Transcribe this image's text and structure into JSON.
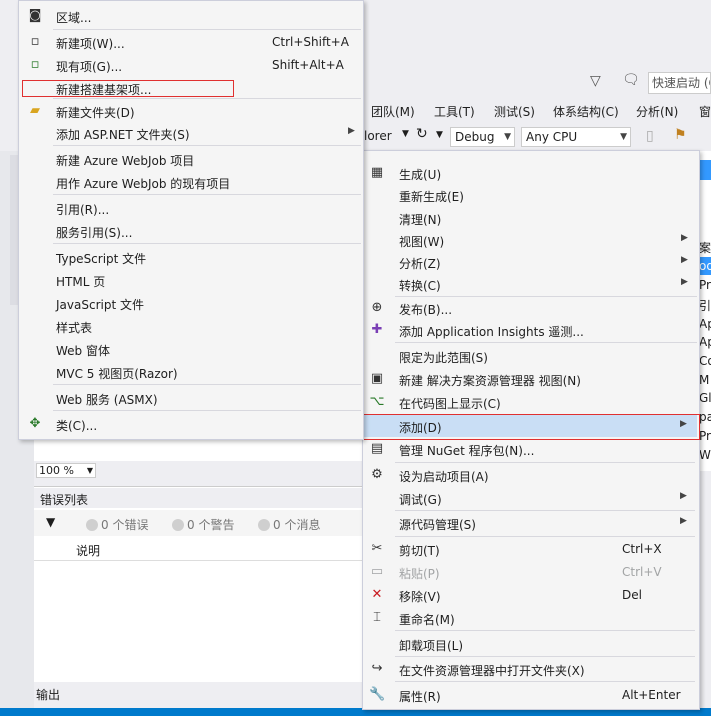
{
  "ide": {
    "menu_bar": [
      "团队(M)",
      "工具(T)",
      "测试(S)",
      "体系结构(C)",
      "分析(N)",
      "窗"
    ],
    "toolbar": {
      "explorer_fragment": "lorer",
      "config": "Debug",
      "platform": "Any CPU"
    },
    "quick_launch_placeholder": "快速启动 (C",
    "zoom": "100 %",
    "error_list": {
      "title": "错误列表",
      "errors": "0 个错误",
      "warnings": "0 个警告",
      "messages": "0 个消息",
      "column_description": "说明"
    },
    "output_label": "输出",
    "right_panel_fragments": [
      "案",
      "od",
      "Pr",
      "引",
      "Ap",
      "Ap",
      "Co",
      "M",
      "Gl",
      "pa",
      "Pr",
      "W"
    ]
  },
  "submenu": {
    "items": [
      {
        "label": "区域...",
        "shortcut": "",
        "icon": "area-icon"
      },
      {
        "label": "新建项(W)...",
        "shortcut": "Ctrl+Shift+A",
        "icon": "new-item-icon"
      },
      {
        "label": "现有项(G)...",
        "shortcut": "Shift+Alt+A",
        "icon": "existing-item-icon"
      },
      {
        "label": "新建搭建基架项...",
        "shortcut": "",
        "icon": ""
      },
      {
        "label": "新建文件夹(D)",
        "shortcut": "",
        "icon": "folder-icon"
      },
      {
        "label": "添加 ASP.NET 文件夹(S)",
        "shortcut": "",
        "icon": "",
        "submenu": true
      },
      {
        "label": "新建 Azure WebJob 项目",
        "shortcut": "",
        "icon": ""
      },
      {
        "label": "用作 Azure WebJob 的现有项目",
        "shortcut": "",
        "icon": ""
      },
      {
        "label": "引用(R)...",
        "shortcut": "",
        "icon": ""
      },
      {
        "label": "服务引用(S)...",
        "shortcut": "",
        "icon": ""
      },
      {
        "label": "TypeScript 文件",
        "shortcut": "",
        "icon": ""
      },
      {
        "label": "HTML 页",
        "shortcut": "",
        "icon": ""
      },
      {
        "label": "JavaScript 文件",
        "shortcut": "",
        "icon": ""
      },
      {
        "label": "样式表",
        "shortcut": "",
        "icon": ""
      },
      {
        "label": "Web 窗体",
        "shortcut": "",
        "icon": ""
      },
      {
        "label": "MVC 5 视图页(Razor)",
        "shortcut": "",
        "icon": ""
      },
      {
        "label": "Web 服务 (ASMX)",
        "shortcut": "",
        "icon": ""
      },
      {
        "label": "类(C)...",
        "shortcut": "",
        "icon": "class-icon"
      }
    ]
  },
  "context_menu": {
    "items": [
      {
        "label": "生成(U)",
        "shortcut": "",
        "icon": "build-icon"
      },
      {
        "label": "重新生成(E)",
        "shortcut": ""
      },
      {
        "label": "清理(N)",
        "shortcut": ""
      },
      {
        "label": "视图(W)",
        "shortcut": "",
        "submenu": true
      },
      {
        "label": "分析(Z)",
        "shortcut": "",
        "submenu": true
      },
      {
        "label": "转换(C)",
        "shortcut": "",
        "submenu": true
      },
      {
        "label": "发布(B)...",
        "shortcut": "",
        "icon": "publish-icon"
      },
      {
        "label": "添加 Application Insights 遥测...",
        "shortcut": "",
        "icon": "insights-icon"
      },
      {
        "label": "限定为此范围(S)",
        "shortcut": ""
      },
      {
        "label": "新建 解决方案资源管理器 视图(N)",
        "shortcut": "",
        "icon": "new-view-icon"
      },
      {
        "label": "在代码图上显示(C)",
        "shortcut": "",
        "icon": "code-map-icon"
      },
      {
        "label": "添加(D)",
        "shortcut": "",
        "submenu": true
      },
      {
        "label": "管理 NuGet 程序包(N)...",
        "shortcut": "",
        "icon": "nuget-icon"
      },
      {
        "label": "设为启动项目(A)",
        "shortcut": "",
        "icon": "gear-icon"
      },
      {
        "label": "调试(G)",
        "shortcut": "",
        "submenu": true
      },
      {
        "label": "源代码管理(S)",
        "shortcut": "",
        "submenu": true
      },
      {
        "label": "剪切(T)",
        "shortcut": "Ctrl+X",
        "icon": "cut-icon"
      },
      {
        "label": "粘贴(P)",
        "shortcut": "Ctrl+V",
        "icon": "paste-icon",
        "disabled": true
      },
      {
        "label": "移除(V)",
        "shortcut": "Del",
        "icon": "remove-icon"
      },
      {
        "label": "重命名(M)",
        "shortcut": "",
        "icon": "rename-icon"
      },
      {
        "label": "卸载项目(L)",
        "shortcut": ""
      },
      {
        "label": "在文件资源管理器中打开文件夹(X)",
        "shortcut": "",
        "icon": "open-folder-icon"
      },
      {
        "label": "属性(R)",
        "shortcut": "Alt+Enter",
        "icon": "wrench-icon"
      }
    ]
  },
  "colors": {
    "highlight_border": "#e03030",
    "hover": "#c9def5",
    "accent": "#007acc"
  }
}
